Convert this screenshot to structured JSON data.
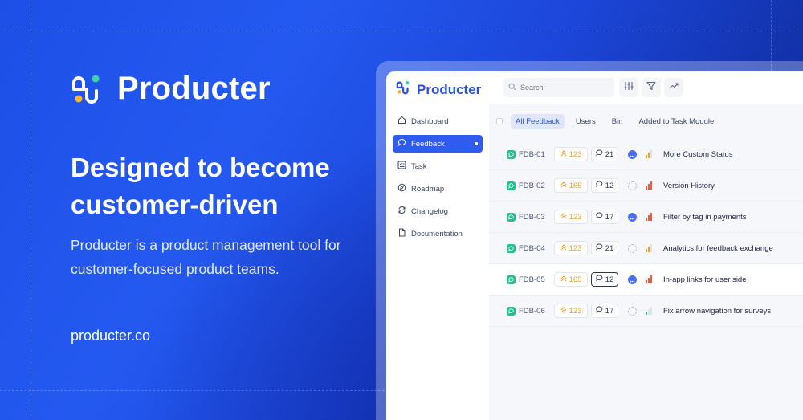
{
  "hero": {
    "brand_name": "Producter",
    "headline": "Designed to become customer-driven",
    "subtext": "Producter is a product management tool for customer-focused product teams.",
    "website": "producter.co"
  },
  "colors": {
    "brand_blue": "#2a4fdb",
    "active_blue": "#2f5bef",
    "status_green": "#22c08a",
    "vote_orange": "#f2a227",
    "priority_red": "#f25a3c"
  },
  "app": {
    "brand_name": "Producter",
    "search": {
      "placeholder": "Search",
      "icon": "search-icon"
    },
    "toolbar": [
      {
        "icon": "sliders-icon"
      },
      {
        "icon": "filter-icon"
      },
      {
        "icon": "trend-icon"
      }
    ],
    "sidebar": {
      "items": [
        {
          "label": "Dashboard",
          "icon": "home-icon",
          "active": false
        },
        {
          "label": "Feedback",
          "icon": "chat-bubble-icon",
          "active": true
        },
        {
          "label": "Task",
          "icon": "task-icon",
          "active": false
        },
        {
          "label": "Roadmap",
          "icon": "compass-icon",
          "active": false
        },
        {
          "label": "Changelog",
          "icon": "refresh-icon",
          "active": false
        },
        {
          "label": "Documentation",
          "icon": "document-icon",
          "active": false
        }
      ]
    },
    "tabs": [
      {
        "label": "All Feedback",
        "active": true
      },
      {
        "label": "Users",
        "active": false
      },
      {
        "label": "Bin",
        "active": false
      },
      {
        "label": "Added to Task Module",
        "active": false
      }
    ],
    "feedback_rows": [
      {
        "id": "FDB-01",
        "votes": "123",
        "comments": "21",
        "status": "in-progress",
        "priority": "medium",
        "title": "More Custom Status"
      },
      {
        "id": "FDB-02",
        "votes": "165",
        "comments": "12",
        "status": "open",
        "priority": "high",
        "title": "Version History"
      },
      {
        "id": "FDB-03",
        "votes": "123",
        "comments": "17",
        "status": "in-progress",
        "priority": "high",
        "title": "Filter by tag in payments"
      },
      {
        "id": "FDB-04",
        "votes": "123",
        "comments": "21",
        "status": "open",
        "priority": "medium",
        "title": "Analytics for feedback exchange"
      },
      {
        "id": "FDB-05",
        "votes": "165",
        "comments": "12",
        "status": "in-progress",
        "priority": "high",
        "title": "In-app links for user side"
      },
      {
        "id": "FDB-06",
        "votes": "123",
        "comments": "17",
        "status": "open",
        "priority": "low",
        "title": "Fix arrow navigation for surveys"
      }
    ]
  }
}
